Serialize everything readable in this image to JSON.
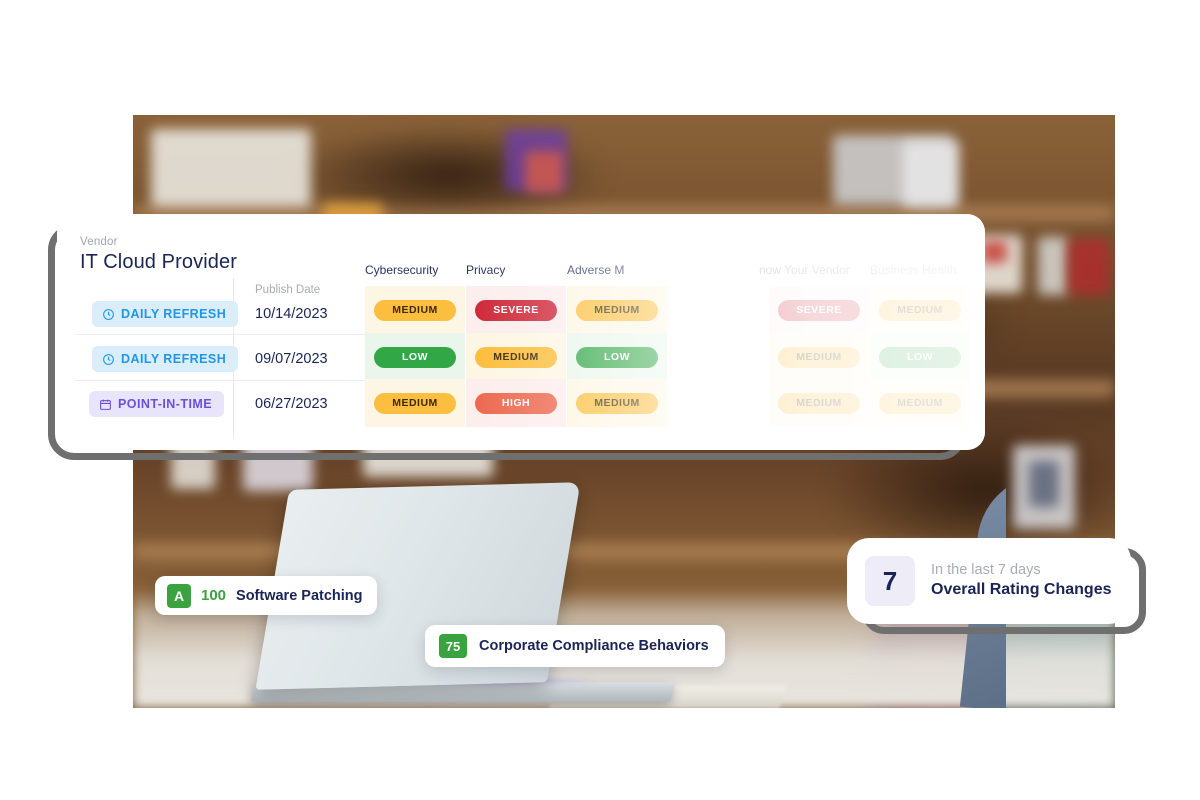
{
  "vendor_panel": {
    "vendor_label": "Vendor",
    "vendor_name": "IT Cloud Provider",
    "publish_date_header": "Publish Date",
    "columns": [
      {
        "label": "Cybersecurity"
      },
      {
        "label": "Privacy"
      },
      {
        "label": "Adverse M"
      },
      {
        "label": "now Your Vendor"
      },
      {
        "label": "Business Health"
      }
    ],
    "rows": [
      {
        "refresh_type": "DAILY REFRESH",
        "refresh_icon": "clock-icon",
        "refresh_style": "refresh",
        "publish_date": "10/14/2023",
        "ratings": [
          "MEDIUM",
          "SEVERE",
          "MEDIUM",
          "SEVERE",
          "MEDIUM"
        ]
      },
      {
        "refresh_type": "DAILY REFRESH",
        "refresh_icon": "clock-icon",
        "refresh_style": "refresh",
        "publish_date": "09/07/2023",
        "ratings": [
          "LOW",
          "MEDIUM",
          "LOW",
          "MEDIUM",
          "LOW"
        ]
      },
      {
        "refresh_type": "POINT-IN-TIME",
        "refresh_icon": "calendar-icon",
        "refresh_style": "pit",
        "publish_date": "06/27/2023",
        "ratings": [
          "MEDIUM",
          "HIGH",
          "MEDIUM",
          "MEDIUM",
          "MEDIUM"
        ]
      }
    ]
  },
  "score_cards": [
    {
      "grade": "A",
      "score": "100",
      "label": "Software Patching"
    },
    {
      "grade": "75",
      "score": "",
      "label": "Corporate Compliance Behaviors"
    }
  ],
  "rating_changes_card": {
    "count": "7",
    "subtitle": "In the last 7 days",
    "title": "Overall Rating Changes"
  },
  "colors": {
    "medium": "#fcbe3e",
    "low": "#31a746",
    "high": "#ec6a50",
    "severe": "#cf2b3c",
    "navy": "#1b2456",
    "refresh_blue": "#2196e6",
    "point_in_time_purple": "#6c4fd6",
    "green_score": "#3aa33f"
  }
}
